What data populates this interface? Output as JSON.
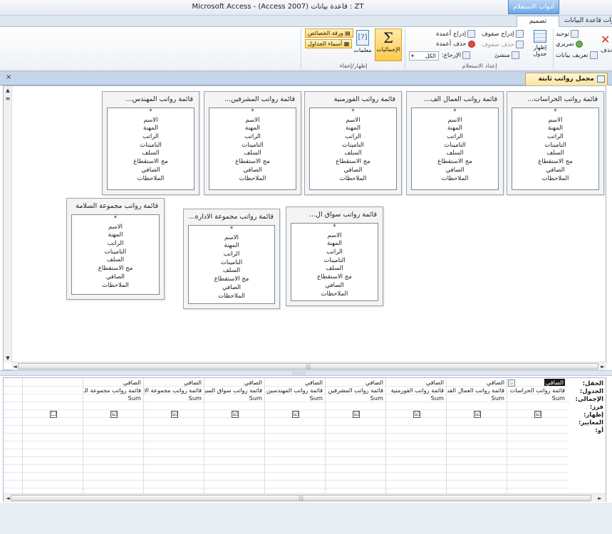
{
  "window": {
    "title": "Microsoft Access - (Access 2007) قاعدة بيانات : ZT",
    "contextual_group": "أدوات الاستعلام"
  },
  "ribbon": {
    "tabs": {
      "design": "تصميم",
      "database_tools": "أدوات قاعدة البيانات"
    },
    "groups": {
      "query_setup": "إعداد الاستعلام",
      "show_hide": "إظهار/إخفاء"
    },
    "buttons": {
      "union": "توحيد",
      "pass_through": "تمريري",
      "data_definition": "تعريف بيانات",
      "delete_partial": "حذف",
      "show_table": "إظهار جدول",
      "insert_rows": "إدراج صفوف",
      "delete_rows": "حذف صفوف",
      "builder": "منشئ",
      "insert_columns": "إدراج أعمدة",
      "delete_columns": "حذف أعمدة",
      "return_label": "الإرجاع:",
      "return_value": "الكل",
      "totals": "الإجماليات",
      "parameters": "معلمات",
      "property_sheet": "ورقة الخصائص",
      "table_names": "أسماء الجداول"
    }
  },
  "document": {
    "tab_label": "مجمل رواتب ثابتة",
    "close_glyph": "×"
  },
  "tables": [
    {
      "title": "قائمة رواتب الحراسات...",
      "fields": [
        "*",
        "الاسم",
        "المهنة",
        "الراتب",
        "التامينات",
        "السلف",
        "مج الاستقطاع",
        "الصافي",
        "الملاحظات"
      ]
    },
    {
      "title": "قائمة رواتب العمال الف...",
      "fields": [
        "*",
        "الاسم",
        "المهنة",
        "الراتب",
        "التامينات",
        "السلف",
        "مج الاستقطاع",
        "الصافي",
        "الملاحظات"
      ]
    },
    {
      "title": "قائمة رواتب الفورمنية",
      "fields": [
        "*",
        "الاسم",
        "المهنة",
        "الراتب",
        "التامينات",
        "السلف",
        "مج الاستقطاع",
        "الصافي",
        "الملاحظات"
      ]
    },
    {
      "title": "قائمة رواتب المشرفين...",
      "fields": [
        "*",
        "الاسم",
        "المهنة",
        "الراتب",
        "التامينات",
        "السلف",
        "مج الاستقطاع",
        "الصافي",
        "الملاحظات"
      ]
    },
    {
      "title": "قائمة رواتب المهندس...",
      "fields": [
        "*",
        "الاسم",
        "المهنة",
        "الراتب",
        "التامينات",
        "السلف",
        "مج الاستقطاع",
        "الصافي",
        "الملاحظات"
      ]
    },
    {
      "title": "قائمة رواتب سواق ال...",
      "fields": [
        "*",
        "الاسم",
        "المهنة",
        "الراتب",
        "التامينات",
        "السلف",
        "مج الاستقطاع",
        "الصافي",
        "الملاحظات"
      ]
    },
    {
      "title": "قائمة رواتب مجموعة الادارة...",
      "fields": [
        "*",
        "الاسم",
        "المهنة",
        "الراتب",
        "التامينات",
        "السلف",
        "مج الاستقطاع",
        "الصافي",
        "الملاحظات"
      ]
    },
    {
      "title": "قائمة رواتب مجموعة السلامة",
      "fields": [
        "*",
        "الاسم",
        "المهنة",
        "الراتب",
        "التامينات",
        "السلف",
        "مج الاستقطاع",
        "الصافي",
        "الملاحظات"
      ]
    }
  ],
  "grid": {
    "row_labels": [
      "الحقل:",
      "الجدول:",
      "الإجمالي:",
      "فرز:",
      "إظهار:",
      "المعايير:",
      "أو:"
    ],
    "columns": [
      {
        "field": "الصافي",
        "table": "قائمة رواتب الحراسات وا",
        "total": "Sum",
        "show": "☑"
      },
      {
        "field": "الصافي",
        "table": "قائمة رواتب العمال الفنيو",
        "total": "Sum",
        "show": "☑"
      },
      {
        "field": "الصافي",
        "table": "قائمة رواتب الفورمنية",
        "total": "Sum",
        "show": "☑"
      },
      {
        "field": "الصافي",
        "table": "قائمة رواتب المشرفين و",
        "total": "Sum",
        "show": "☑"
      },
      {
        "field": "الصافي",
        "table": "قائمة رواتب المهندسين",
        "total": "Sum",
        "show": "☑"
      },
      {
        "field": "الصافي",
        "table": "قائمة رواتب سواق السيا",
        "total": "Sum",
        "show": "☑"
      },
      {
        "field": "الصافي",
        "table": "قائمة رواتب مجموعة الادا",
        "total": "Sum",
        "show": "☑"
      },
      {
        "field": "الصافي",
        "table": "قائمة رواتب مجموعة السلا",
        "total": "Sum",
        "show": "☑"
      },
      {
        "field": "",
        "table": "",
        "total": "",
        "show": "☐"
      }
    ],
    "dropdown_glyph": "⌵"
  },
  "scroll": {
    "up": "▲",
    "down": "▼",
    "left": "◄",
    "right": "►",
    "grip": "|||",
    "splitter_grip": "::::::::"
  }
}
